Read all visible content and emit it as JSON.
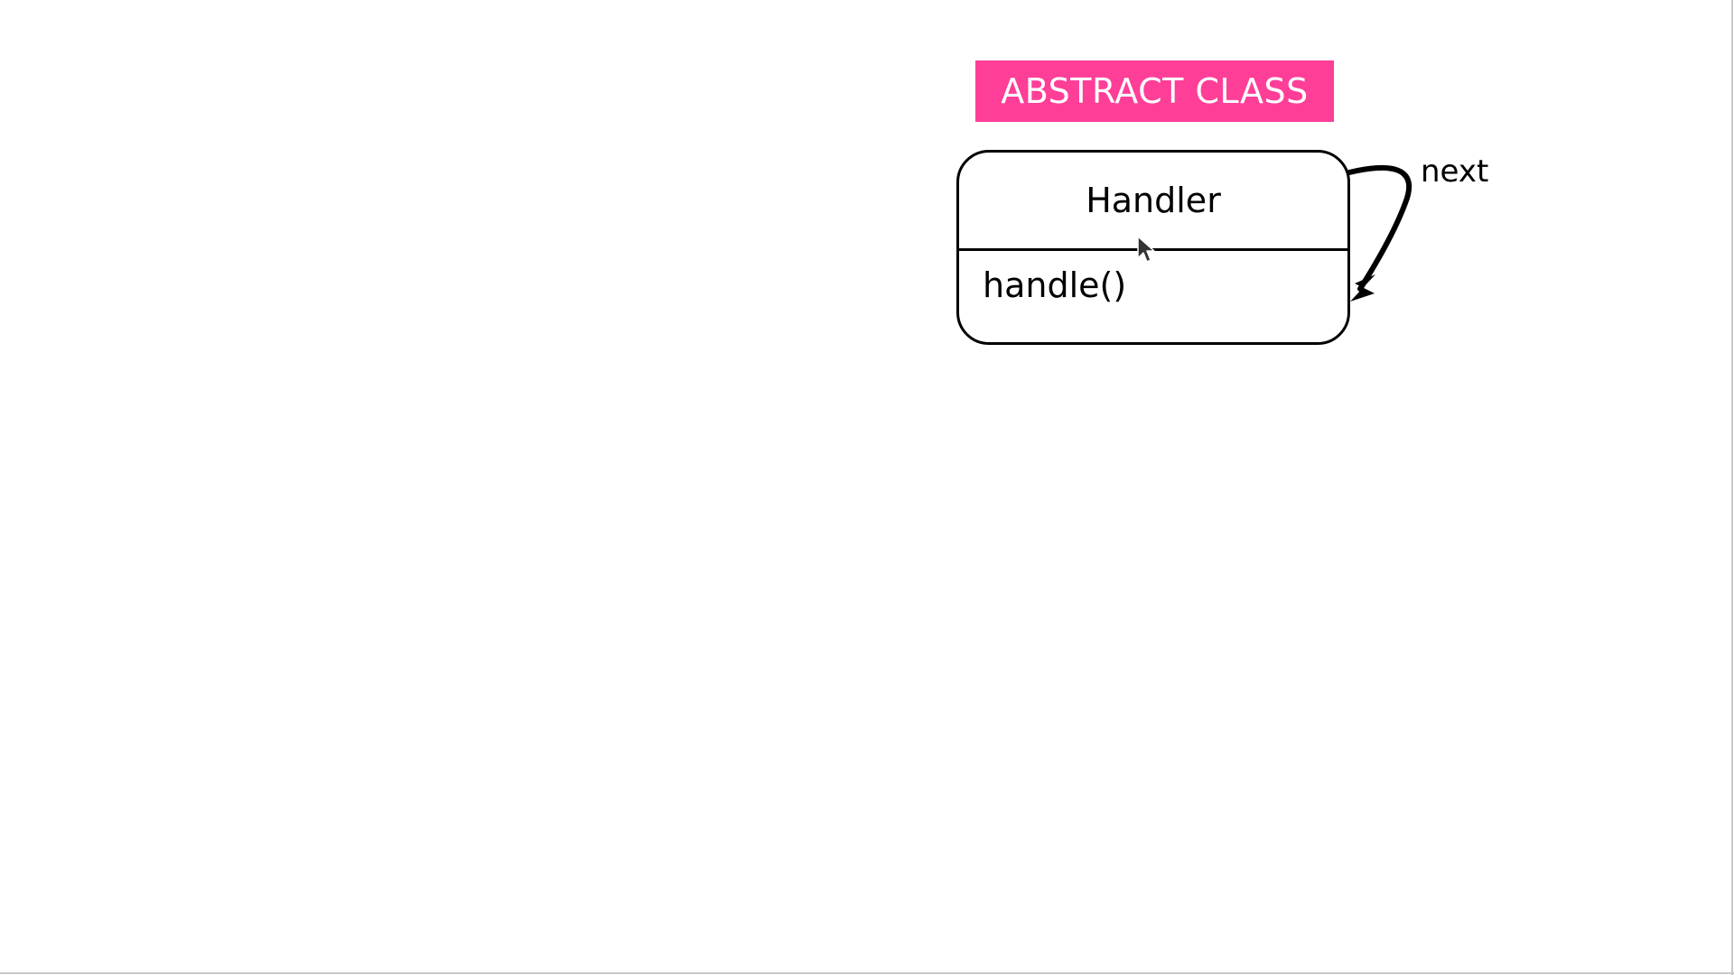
{
  "diagram": {
    "badge": {
      "text": "ABSTRACT CLASS",
      "color": "#FF3E98"
    },
    "class_box": {
      "name": "Handler",
      "methods": [
        "handle()"
      ]
    },
    "self_association": {
      "label": "next",
      "from": "Handler",
      "to": "Handler"
    }
  },
  "icons": {
    "pointer": "mouse-pointer-icon"
  }
}
